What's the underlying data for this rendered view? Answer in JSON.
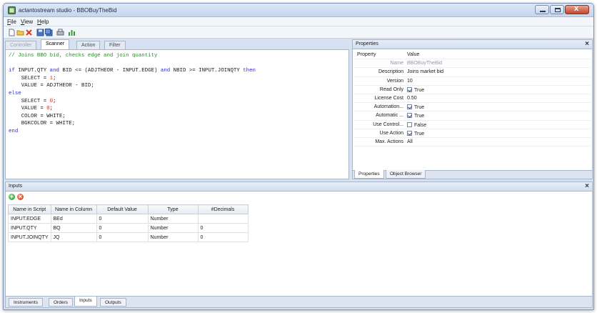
{
  "window": {
    "title": "actantostream studio - BBOBuyTheBid"
  },
  "menu": [
    "File",
    "View",
    "Help"
  ],
  "toolbar": {
    "icons": [
      "new-icon",
      "open-folder-icon",
      "delete-icon",
      "save-icon",
      "save-all-icon",
      "print-icon",
      "chart-icon"
    ]
  },
  "editor": {
    "tabs": [
      "Controller",
      "Scanner",
      "Action",
      "Filter"
    ],
    "active_tab": "Scanner",
    "lines": [
      [
        {
          "t": "// Joins BBO bid, checks edge and join quantity",
          "c": "comment"
        }
      ],
      [],
      [
        {
          "t": "if",
          "c": "kw"
        },
        {
          "t": " INPUT.QTY ",
          "c": ""
        },
        {
          "t": "and",
          "c": "kw"
        },
        {
          "t": " BID <= (ADJTHEOR - INPUT.EDGE) ",
          "c": ""
        },
        {
          "t": "and",
          "c": "kw"
        },
        {
          "t": " NBID >= INPUT.JOINQTY ",
          "c": ""
        },
        {
          "t": "then",
          "c": "kw"
        }
      ],
      [
        {
          "t": "    SELECT = ",
          "c": ""
        },
        {
          "t": "1",
          "c": "num"
        },
        {
          "t": ";",
          "c": ""
        }
      ],
      [
        {
          "t": "    VALUE = ADJTHEOR - BID;",
          "c": ""
        }
      ],
      [
        {
          "t": "else",
          "c": "kw"
        }
      ],
      [
        {
          "t": "    SELECT = ",
          "c": ""
        },
        {
          "t": "0",
          "c": "num"
        },
        {
          "t": ";",
          "c": ""
        }
      ],
      [
        {
          "t": "    VALUE = ",
          "c": ""
        },
        {
          "t": "0",
          "c": "num"
        },
        {
          "t": ";",
          "c": ""
        }
      ],
      [
        {
          "t": "    COLOR = WHITE;",
          "c": ""
        }
      ],
      [
        {
          "t": "    BGKCOLOR = WHITE;",
          "c": ""
        }
      ],
      [
        {
          "t": "end",
          "c": "kw"
        }
      ]
    ]
  },
  "properties": {
    "title": "Properties",
    "close": "×",
    "header": {
      "name": "Property",
      "value": "Value"
    },
    "rows": [
      {
        "name": "Name",
        "value": "BBOBuyTheBid",
        "grey": true
      },
      {
        "name": "Description",
        "value": "Joins market bid"
      },
      {
        "name": "Version",
        "value": "10"
      },
      {
        "name": "Read Only",
        "value": "True",
        "checkbox": true,
        "checked": true
      },
      {
        "name": "License Cost",
        "value": "0.50"
      },
      {
        "name": "Automation...",
        "value": "True",
        "checkbox": true,
        "checked": true
      },
      {
        "name": "Automatic ...",
        "value": "True",
        "checkbox": true,
        "checked": true
      },
      {
        "name": "Use Control...",
        "value": "False",
        "checkbox": true,
        "checked": false
      },
      {
        "name": "Use Action",
        "value": "True",
        "checkbox": true,
        "checked": true
      },
      {
        "name": "Max. Actions",
        "value": "All"
      }
    ],
    "tabs": [
      "Properties",
      "Object Browser"
    ]
  },
  "inputs": {
    "title": "Inputs",
    "close": "×",
    "add_label": "+",
    "remove_label": "×",
    "columns": [
      "Name in Script",
      "Name in Column",
      "Default Value",
      "Type",
      "#Decimals"
    ],
    "rows": [
      [
        "INPUT.EDGE",
        "BEd",
        "0",
        "Number",
        ""
      ],
      [
        "INPUT.QTY",
        "BQ",
        "0",
        "Number",
        "0"
      ],
      [
        "INPUT.JOINQTY",
        "JQ",
        "0",
        "Number",
        "0"
      ]
    ],
    "bottom_tabs": [
      "Instruments",
      "Orders",
      "Inputs",
      "Outputs"
    ],
    "active_bottom_tab": "Inputs"
  }
}
